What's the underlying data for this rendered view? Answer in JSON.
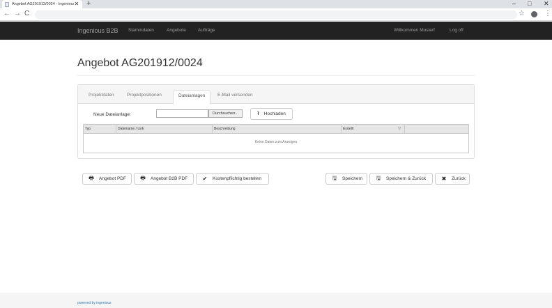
{
  "browser": {
    "tab_title": "Angebot AG201912/0024 - Ingenious B2B",
    "tab_close": "✕",
    "new_tab": "+",
    "back": "←",
    "forward": "→",
    "reload": "C",
    "bookmark": "☆",
    "menu": "⋮",
    "minimize": "–",
    "maximize": "□",
    "close": "✕"
  },
  "navbar": {
    "brand": "Ingenious B2B",
    "links": [
      "Stammdaten",
      "Angebote",
      "Aufträge"
    ],
    "welcome": "Willkommen Musterf",
    "logout": "Log off"
  },
  "page": {
    "title": "Angebot AG201912/0024"
  },
  "tabs": [
    "Projektdaten",
    "Projektpositionen",
    "Dateianlagen",
    "E-Mail versenden"
  ],
  "active_tab": "Dateianlagen",
  "upload": {
    "label": "Neue Dateianlage:",
    "browse": "Durchsuchen...",
    "button": "Hochladen",
    "icon": "upload-icon"
  },
  "table": {
    "columns": [
      "Typ",
      "Dateiname / Link",
      "Beschreibung",
      "Erstellt"
    ],
    "sort_icon": "▽",
    "empty": "Keine Daten zum Anzeigen"
  },
  "actions": {
    "pdf": "Angebot PDF",
    "b2b_pdf": "Angebot B2B PDF",
    "order": "Kostenpflichtig bestellen",
    "save": "Speichern",
    "save_back": "Speichern & Zurück",
    "back": "Zurück"
  },
  "icons": {
    "print": "🖶",
    "check": "✔",
    "save": "🖫",
    "close": "✖",
    "upload": "⭱"
  },
  "footer": {
    "text": "powered by ingenious"
  },
  "colors": {
    "navbar": "#222222",
    "link": "#337ab7"
  }
}
